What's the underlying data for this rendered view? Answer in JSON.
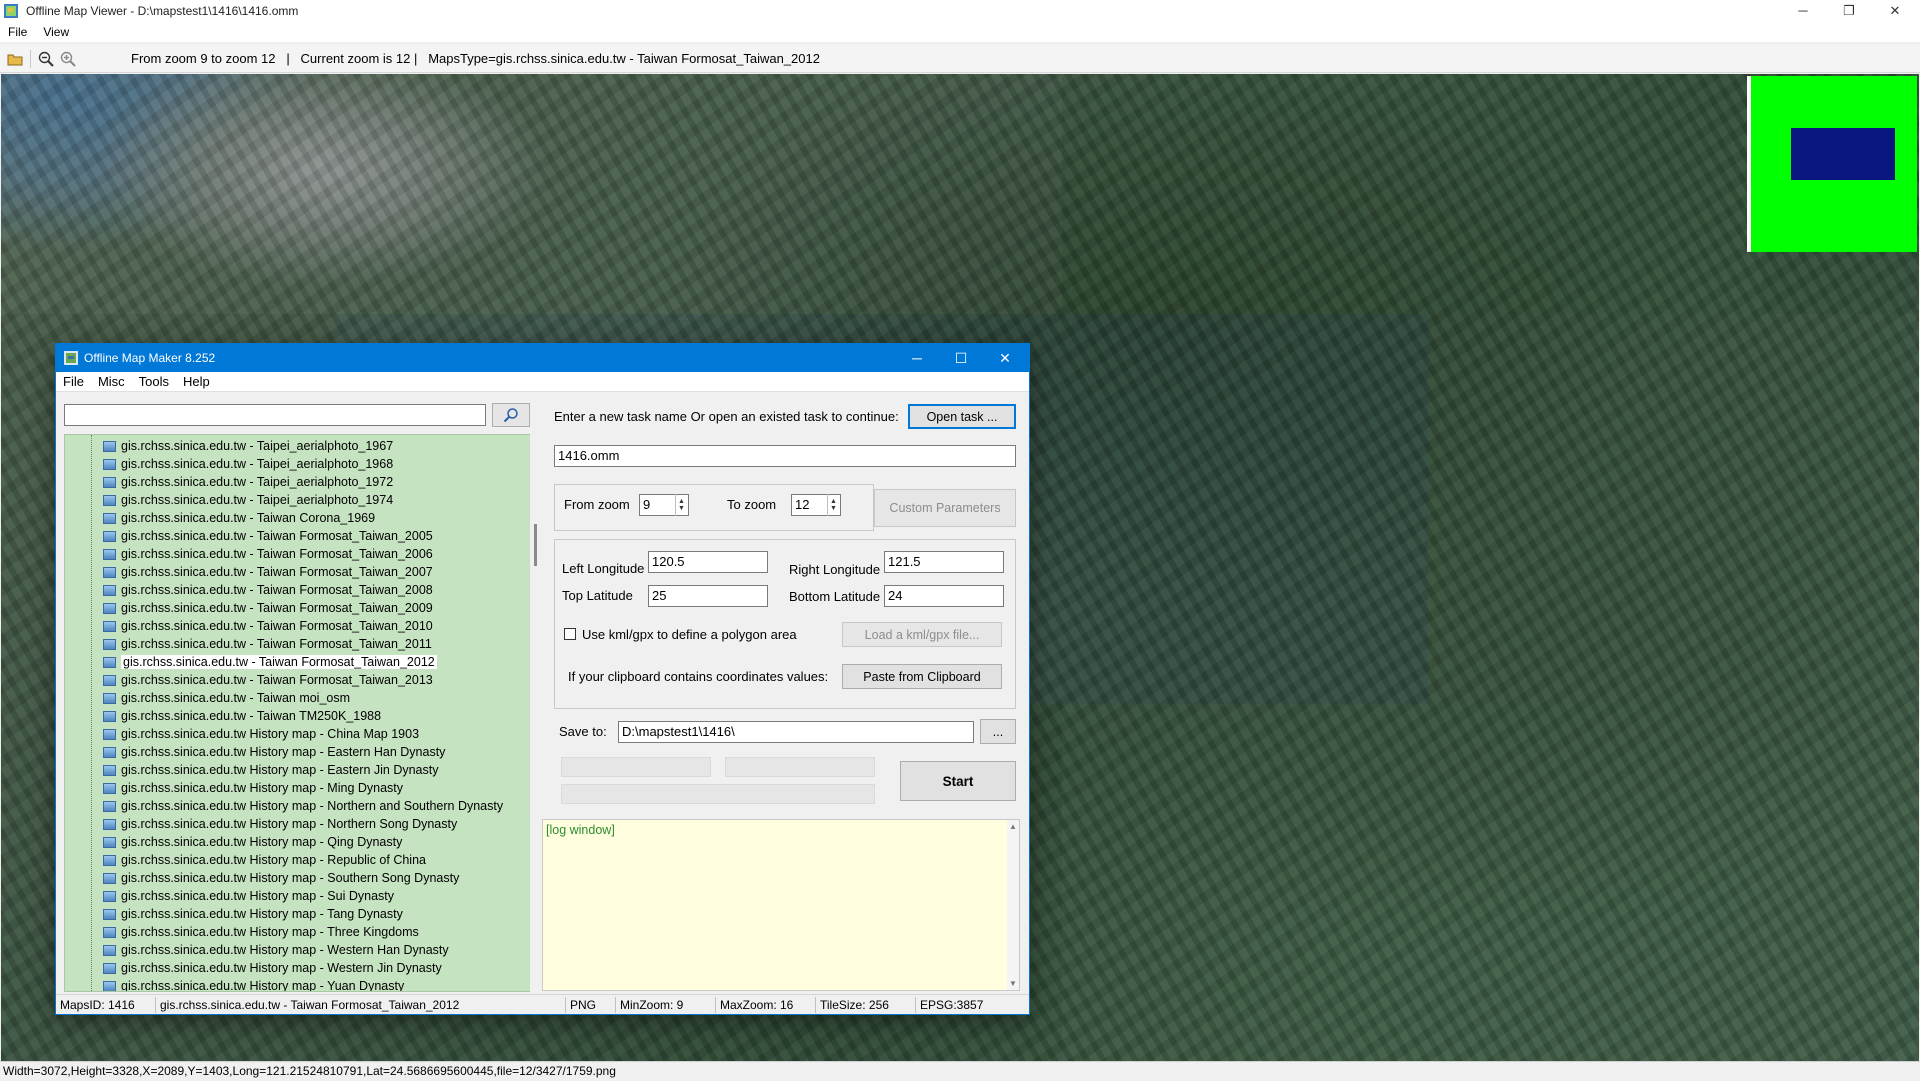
{
  "window": {
    "title": "Offline Map Viewer - D:\\mapstest1\\1416\\1416.omm",
    "minimize": "─",
    "maximize": "❐",
    "close": "✕"
  },
  "menu": [
    "File",
    "View"
  ],
  "toolbar": {
    "info": "From zoom 9 to zoom 12   |   Current zoom is 12 |   MapsType=gis.rchss.sinica.edu.tw - Taiwan Formosat_Taiwan_2012"
  },
  "statusbar": {
    "text": "Width=3072,Height=3328,X=2089,Y=1403,Long=121.21524810791,Lat=24.5686695600445,file=12/3427/1759.png"
  },
  "dialog": {
    "title": "Offline Map Maker 8.252",
    "minimize": "─",
    "maximize": "☐",
    "close": "✕",
    "menu": [
      "File",
      "Misc",
      "Tools",
      "Help"
    ],
    "search": {
      "value": "",
      "placeholder": ""
    },
    "tree_items": [
      {
        "label": "gis.rchss.sinica.edu.tw - Taipei_aerialphoto_1967",
        "selected": false
      },
      {
        "label": "gis.rchss.sinica.edu.tw - Taipei_aerialphoto_1968",
        "selected": false
      },
      {
        "label": "gis.rchss.sinica.edu.tw - Taipei_aerialphoto_1972",
        "selected": false
      },
      {
        "label": "gis.rchss.sinica.edu.tw - Taipei_aerialphoto_1974",
        "selected": false
      },
      {
        "label": "gis.rchss.sinica.edu.tw - Taiwan Corona_1969",
        "selected": false
      },
      {
        "label": "gis.rchss.sinica.edu.tw - Taiwan Formosat_Taiwan_2005",
        "selected": false
      },
      {
        "label": "gis.rchss.sinica.edu.tw - Taiwan Formosat_Taiwan_2006",
        "selected": false
      },
      {
        "label": "gis.rchss.sinica.edu.tw - Taiwan Formosat_Taiwan_2007",
        "selected": false
      },
      {
        "label": "gis.rchss.sinica.edu.tw - Taiwan Formosat_Taiwan_2008",
        "selected": false
      },
      {
        "label": "gis.rchss.sinica.edu.tw - Taiwan Formosat_Taiwan_2009",
        "selected": false
      },
      {
        "label": "gis.rchss.sinica.edu.tw - Taiwan Formosat_Taiwan_2010",
        "selected": false
      },
      {
        "label": "gis.rchss.sinica.edu.tw - Taiwan Formosat_Taiwan_2011",
        "selected": false
      },
      {
        "label": "gis.rchss.sinica.edu.tw - Taiwan Formosat_Taiwan_2012",
        "selected": true
      },
      {
        "label": "gis.rchss.sinica.edu.tw - Taiwan Formosat_Taiwan_2013",
        "selected": false
      },
      {
        "label": "gis.rchss.sinica.edu.tw - Taiwan moi_osm",
        "selected": false
      },
      {
        "label": "gis.rchss.sinica.edu.tw - Taiwan TM250K_1988",
        "selected": false
      },
      {
        "label": "gis.rchss.sinica.edu.tw History map - China Map 1903",
        "selected": false
      },
      {
        "label": "gis.rchss.sinica.edu.tw History map - Eastern Han Dynasty",
        "selected": false
      },
      {
        "label": "gis.rchss.sinica.edu.tw History map - Eastern Jin Dynasty",
        "selected": false
      },
      {
        "label": "gis.rchss.sinica.edu.tw History map - Ming Dynasty",
        "selected": false
      },
      {
        "label": "gis.rchss.sinica.edu.tw History map - Northern and Southern Dynasty",
        "selected": false
      },
      {
        "label": "gis.rchss.sinica.edu.tw History map - Northern Song Dynasty",
        "selected": false
      },
      {
        "label": "gis.rchss.sinica.edu.tw History map - Qing Dynasty",
        "selected": false
      },
      {
        "label": "gis.rchss.sinica.edu.tw History map - Republic of China",
        "selected": false
      },
      {
        "label": "gis.rchss.sinica.edu.tw History map - Southern Song Dynasty",
        "selected": false
      },
      {
        "label": "gis.rchss.sinica.edu.tw History map - Sui Dynasty",
        "selected": false
      },
      {
        "label": "gis.rchss.sinica.edu.tw History map - Tang Dynasty",
        "selected": false
      },
      {
        "label": "gis.rchss.sinica.edu.tw History map - Three Kingdoms",
        "selected": false
      },
      {
        "label": "gis.rchss.sinica.edu.tw History map - Western Han Dynasty",
        "selected": false
      },
      {
        "label": "gis.rchss.sinica.edu.tw History map - Western Jin Dynasty",
        "selected": false
      },
      {
        "label": "gis.rchss.sinica.edu.tw History map - Yuan Dynasty",
        "selected": false
      }
    ],
    "task_prompt": "Enter a new task name Or open an existed task to continue:",
    "open_task_button": "Open task ...",
    "task_name": "1416.omm",
    "from_zoom_label": "From zoom",
    "from_zoom_value": "9",
    "to_zoom_label": "To zoom",
    "to_zoom_value": "12",
    "custom_params_button": "Custom Parameters",
    "left_longitude_label": "Left Longitude",
    "left_longitude_value": "120.5",
    "right_longitude_label": "Right Longitude",
    "right_longitude_value": "121.5",
    "top_latitude_label": "Top Latitude",
    "top_latitude_value": "25",
    "bottom_latitude_label": "Bottom Latitude",
    "bottom_latitude_value": "24",
    "kml_checkbox_label": "Use kml/gpx to define a polygon area",
    "load_kml_button": "Load a kml/gpx file...",
    "clipboard_prompt": "If your clipboard contains coordinates values:",
    "paste_button": "Paste from Clipboard",
    "save_to_label": "Save to:",
    "save_to_value": "D:\\mapstest1\\1416\\",
    "browse_button": "...",
    "start_button": "Start",
    "log_text": "[log window]",
    "status": {
      "maps_id": "MapsID: 1416",
      "map_name": "gis.rchss.sinica.edu.tw - Taiwan Formosat_Taiwan_2012",
      "format": "PNG",
      "min_zoom": "MinZoom: 9",
      "max_zoom": "MaxZoom: 16",
      "tile_size": "TileSize: 256",
      "epsg": "EPSG:3857"
    }
  }
}
